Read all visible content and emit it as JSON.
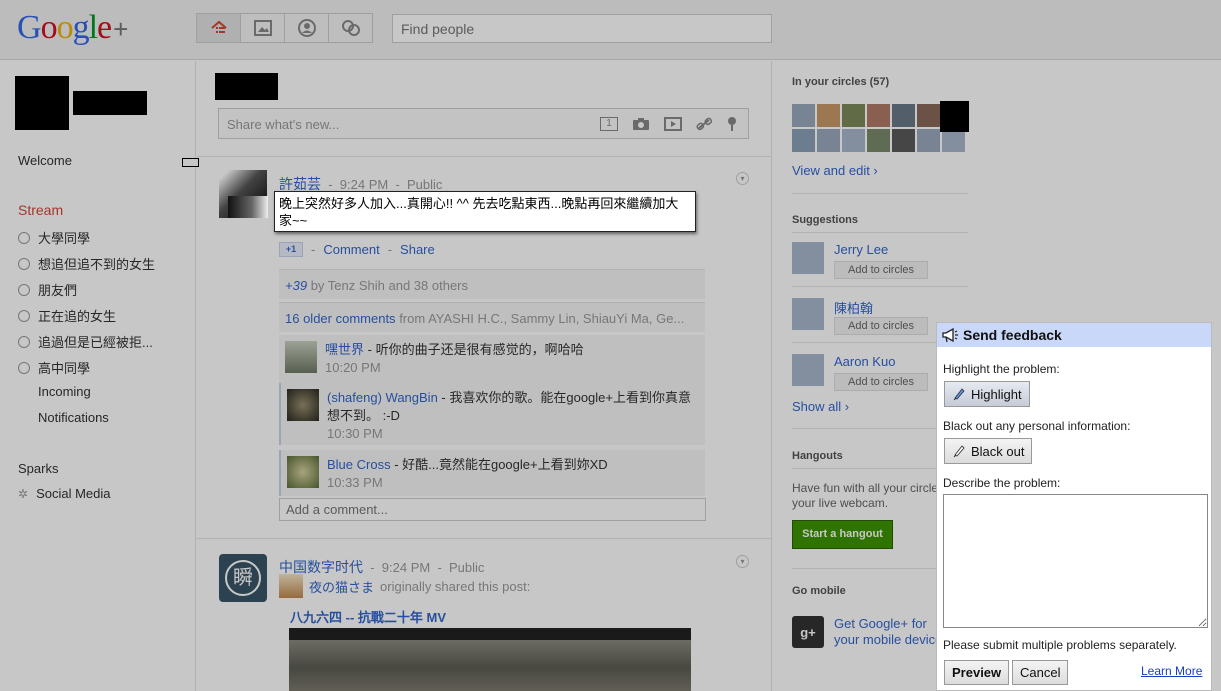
{
  "header": {
    "logo_text": "Google",
    "logo_plus": "+",
    "nav": [
      "home-icon",
      "photos-icon",
      "profile-icon",
      "circles-icon"
    ],
    "search_placeholder": "Find people"
  },
  "leftnav": {
    "welcome": "Welcome",
    "stream": "Stream",
    "circles": [
      "大學同學",
      "想追但追不到的女生",
      "朋友們",
      "正在追的女生",
      "追過但是已經被拒...",
      "高中同學"
    ],
    "incoming": "Incoming",
    "notifications": "Notifications",
    "sparks": "Sparks",
    "social_media": "Social Media"
  },
  "share": {
    "placeholder": "Share what's new..."
  },
  "post1": {
    "author": "許茹芸",
    "time": "9:24 PM",
    "visibility": "Public",
    "text": "晚上突然好多人加入...真開心!! ^^ 先去吃點東西...晚點再回來繼續加大家~~",
    "plus_one": "+1",
    "comment_link": "Comment",
    "share_link": "Share",
    "plus_count": "+39",
    "plus_by": "by Tenz Shih and 38 others",
    "older_comments": "16 older comments",
    "older_from": "from AYASHI H.C., Sammy Lin, ShiauYi Ma, Ge...",
    "comments": [
      {
        "author": "嘿世界",
        "text": " - 听你的曲子还是很有感觉的，啊哈哈",
        "time": "10:20 PM"
      },
      {
        "author": "(shafeng) WangBin",
        "text": " - 我喜欢你的歌。能在google+上看到你真意想不到。 :-D",
        "time": "10:30 PM"
      },
      {
        "author": "Blue Cross",
        "text": " - 好酷...竟然能在google+上看到妳XD",
        "time": "10:33 PM"
      }
    ],
    "add_comment": "Add a comment..."
  },
  "post2": {
    "author": "中国数字时代",
    "time": "9:24 PM",
    "visibility": "Public",
    "reshare_author": "夜の猫さま",
    "reshare_note": "originally shared this post:",
    "link_title": "八九六四 -- 抗戰二十年 MV",
    "logo_char": "瞬"
  },
  "right": {
    "circles_head": "In your circles (57)",
    "view_edit": "View and edit ›",
    "suggestions_head": "Suggestions",
    "suggestions": [
      {
        "name": "Jerry Lee",
        "button": "Add to circles"
      },
      {
        "name": "陳柏翰",
        "button": "Add to circles"
      },
      {
        "name": "Aaron Kuo",
        "button": "Add to circles"
      }
    ],
    "show_all": "Show all ›",
    "hangouts_head": "Hangouts",
    "hangouts_text": "Have fun with all your circles using your live webcam.",
    "hangout_button": "Start a hangout",
    "mobile_head": "Go mobile",
    "mobile_link": "Get Google+ for your mobile device"
  },
  "feedback": {
    "title": "Send feedback",
    "highlight_label": "Highlight the problem:",
    "highlight_button": "Highlight",
    "blackout_label": "Black out any personal information:",
    "blackout_button": "Black out",
    "describe_label": "Describe the problem:",
    "note": "Please submit multiple problems separately.",
    "preview": "Preview",
    "cancel": "Cancel",
    "learn_more": "Learn More"
  },
  "colors": {
    "stream_red": "#d14836",
    "link_blue": "#3366cc",
    "hangout_green": "#3d9400",
    "feedback_title_bg": "#c9d7f8"
  }
}
